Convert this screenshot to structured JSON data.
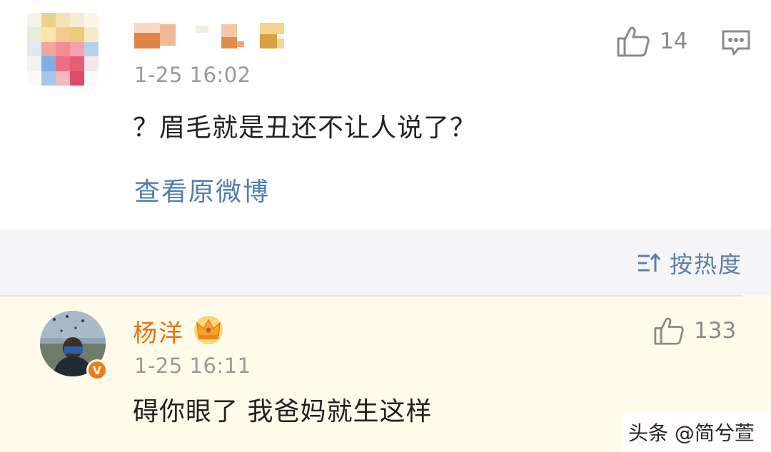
{
  "comment_top": {
    "time": "1-25 16:02",
    "text": "？眉毛就是丑还不让人说了？",
    "like_count": "14",
    "view_original_label": "查看原微博"
  },
  "sort": {
    "label": "按热度"
  },
  "comment_reply": {
    "username": "杨洋",
    "time": "1-25 16:11",
    "text": "碍你眼了 我爸妈就生这样",
    "like_count": "133",
    "verified_badge": "V"
  },
  "watermark": {
    "text": "头条 @简兮萱"
  },
  "colors": {
    "link_blue": "#4f7fae",
    "username_orange": "#e8730e",
    "highlight_bg": "#fffbea",
    "sort_bar_bg": "#f5f5f7",
    "muted_gray": "#9a9a9a"
  },
  "icons": {
    "like": "thumbs-up-icon",
    "reply": "comment-bubble-icon",
    "sort": "sort-icon",
    "crown": "crown-icon",
    "verified": "verified-v-icon"
  }
}
